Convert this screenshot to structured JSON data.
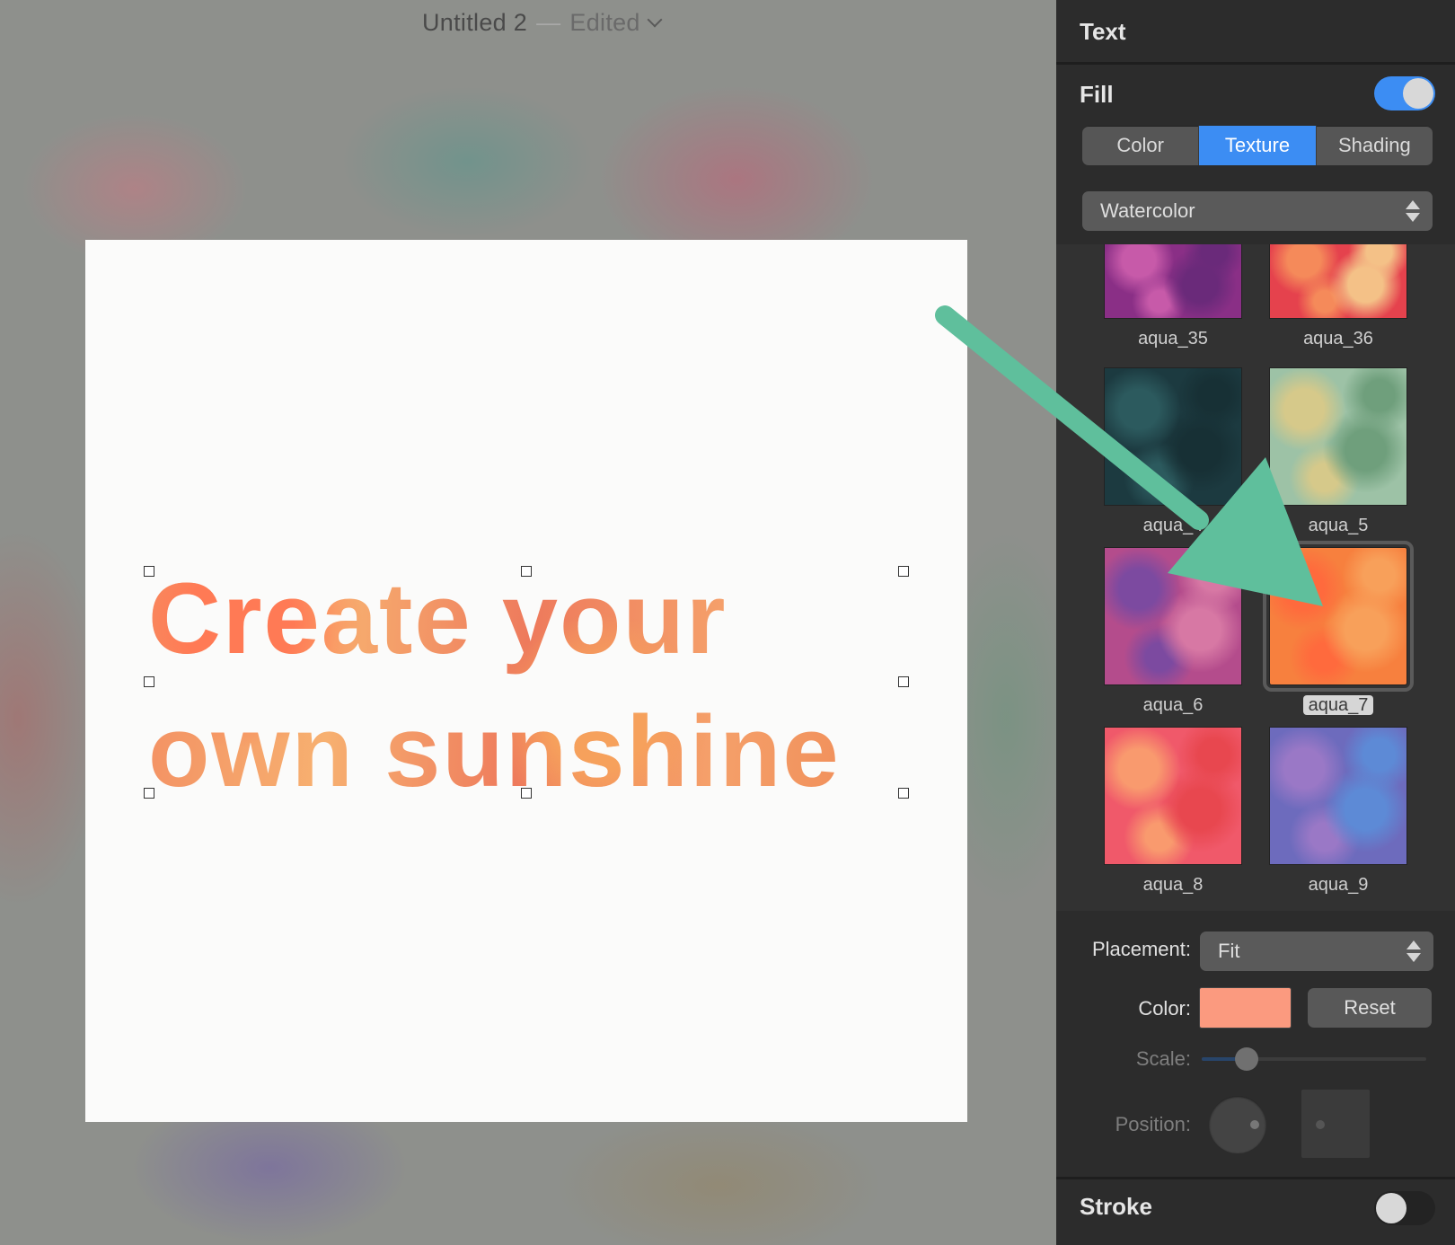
{
  "document": {
    "title": "Untitled 2",
    "status": "Edited"
  },
  "canvas": {
    "text_line1": "Create your",
    "text_line2": "own sunshine"
  },
  "panel": {
    "header": "Text",
    "fill": {
      "label": "Fill",
      "enabled": true,
      "tabs": [
        {
          "label": "Color",
          "active": false
        },
        {
          "label": "Texture",
          "active": true
        },
        {
          "label": "Shading",
          "active": false
        }
      ],
      "texture_category": "Watercolor",
      "textures": [
        {
          "name": "aqua_35",
          "selected": false,
          "colors": [
            "#8a2f86",
            "#c75aa9",
            "#6a2a7a"
          ]
        },
        {
          "name": "aqua_36",
          "selected": false,
          "colors": [
            "#e5424d",
            "#f58a5a",
            "#f4c187"
          ]
        },
        {
          "name": "aqua_4",
          "selected": false,
          "colors": [
            "#1c3a40",
            "#2c5a5e",
            "#173035"
          ]
        },
        {
          "name": "aqua_5",
          "selected": false,
          "colors": [
            "#9dc2a6",
            "#d6c98a",
            "#6f9f7c"
          ]
        },
        {
          "name": "aqua_6",
          "selected": false,
          "colors": [
            "#b44c8c",
            "#7c4aa0",
            "#d778a4"
          ]
        },
        {
          "name": "aqua_7",
          "selected": true,
          "colors": [
            "#f7803e",
            "#ff6a3d",
            "#f8a05a"
          ]
        },
        {
          "name": "aqua_8",
          "selected": false,
          "colors": [
            "#f0596a",
            "#f99a6e",
            "#e8474f"
          ]
        },
        {
          "name": "aqua_9",
          "selected": false,
          "colors": [
            "#6d6bbd",
            "#9a78c6",
            "#5d8ad6"
          ]
        }
      ],
      "placement_label": "Placement:",
      "placement_value": "Fit",
      "color_label": "Color:",
      "color_value": "#fb9a7f",
      "reset_label": "Reset",
      "scale_label": "Scale:",
      "scale_value": 0.2,
      "position_label": "Position:"
    },
    "stroke": {
      "label": "Stroke",
      "enabled": false
    }
  },
  "colors": {
    "accent": "#3c8df3",
    "panel_bg": "#2c2c2c",
    "annotation_arrow": "#5fbf9c"
  }
}
